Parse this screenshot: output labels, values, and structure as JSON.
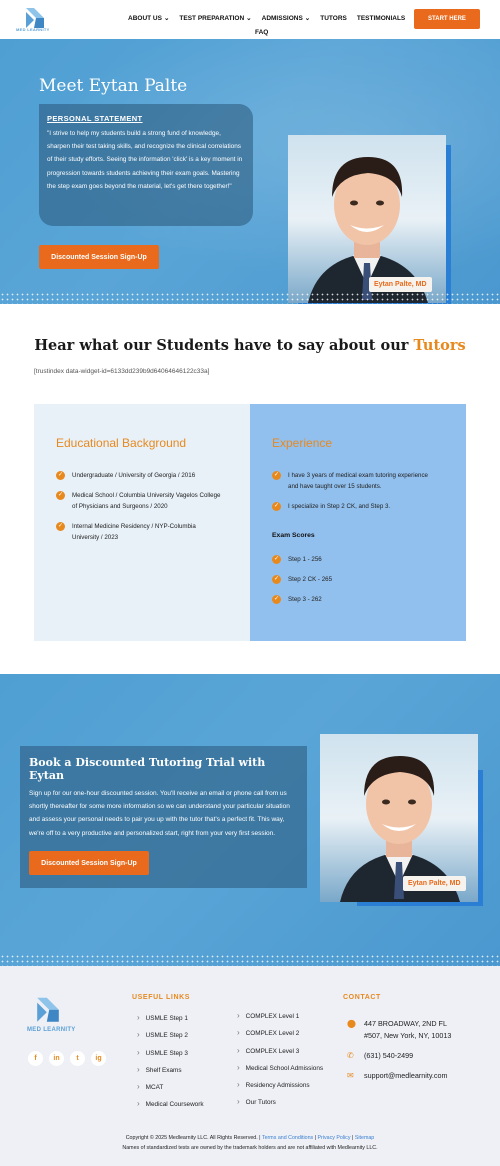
{
  "nav": {
    "logo_text": "MED LEARNITY",
    "items": [
      "ABOUT US",
      "TEST PREPARATION",
      "ADMISSIONS",
      "TUTORS",
      "TESTIMONIALS"
    ],
    "faq": "FAQ",
    "cta": "START HERE"
  },
  "hero": {
    "title": "Meet Eytan Palte",
    "statement_heading": "PERSONAL STATEMENT",
    "statement": "\"I strive to help my students build a strong fund of knowledge, sharpen their test taking skills, and recognize the clinical correlations of their study efforts. Seeing the information 'click' is a key moment in progression towards students achieving their exam goals. Mastering the step exam goes beyond the material, let's get there together!\"",
    "button": "Discounted Session Sign-Up",
    "photo_tag": "Eytan Palte, MD"
  },
  "testimonials": {
    "heading": "Hear what our Students have to say about our",
    "heading_accent": "Tutors",
    "widget": "[trustindex data-widget-id=6133dd239b9d64064646122c33a]"
  },
  "education": {
    "heading": "Educational Background",
    "items": [
      "Undergraduate / University of Georgia / 2016",
      "Medical School / Columbia University Vagelos College of Physicians and Surgeons / 2020",
      "Internal Medicine Residency / NYP-Columbia University / 2023"
    ]
  },
  "experience": {
    "heading": "Experience",
    "items": [
      "I have 3 years of medical exam tutoring experience and have taught over 15 students.",
      "I specialize in Step 2 CK, and Step 3."
    ],
    "scores_heading": "Exam Scores",
    "scores": [
      "Step 1 - 256",
      "Step 2 CK - 265",
      "Step 3 - 262"
    ]
  },
  "book": {
    "title": "Book a Discounted Tutoring Trial with Eytan",
    "text": "Sign up for our one-hour discounted session. You'll receive an email or phone call from us shortly thereafter for some more information so we can understand your particular situation and assess your personal needs to pair you up with the tutor that's a perfect fit. This way, we're off to a very productive and personalized start, right from your very first session.",
    "button": "Discounted Session Sign-Up",
    "photo_tag": "Eytan Palte, MD"
  },
  "footer": {
    "logo_text": "MED LEARNITY",
    "social": [
      "f",
      "in",
      "t",
      "ig"
    ],
    "useful_links_heading": "USEFUL LINKS",
    "links_col1": [
      "USMLE Step 1",
      "USMLE Step 2",
      "USMLE Step 3",
      "Shelf Exams",
      "MCAT",
      "Medical Coursework"
    ],
    "links_col2": [
      "COMPLEX Level 1",
      "COMPLEX Level 2",
      "COMPLEX Level 3",
      "Medical School Admissions",
      "Residency Admissions",
      "Our Tutors"
    ],
    "contact_heading": "CONTACT",
    "address": "447 BROADWAY, 2ND FL #507, New York, NY, 10013",
    "phone": "(631) 540-2499",
    "email": "support@medlearnity.com",
    "copyright": "Copyright © 2025 Medlearnity LLC. All Rights Reserved. |",
    "terms": "Terms and Conditions",
    "privacy": "Privacy Policy",
    "sitemap": "Sitemap",
    "disclaimer": "Names of standardized tests are owned by the trademark holders and are not affiliated with Medlearnity LLC."
  },
  "colors": {
    "accent": "#e96a1c",
    "brand_blue": "#5aa5d7",
    "panel_blue": "#92c0ee"
  }
}
